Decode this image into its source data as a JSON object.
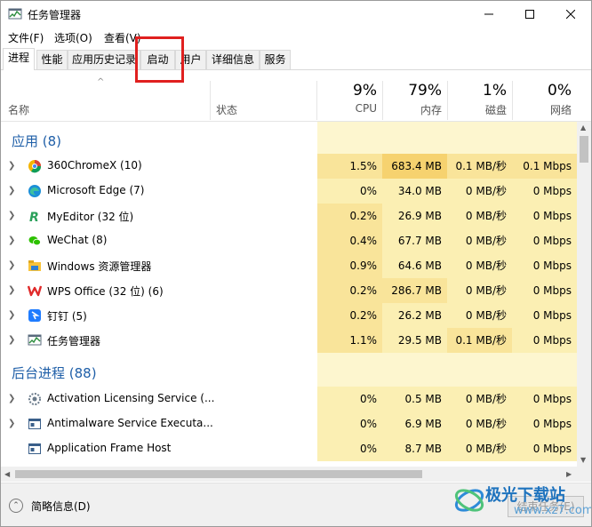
{
  "window": {
    "title": "任务管理器",
    "controls": {
      "minimize": "—",
      "maximize": "☐",
      "close": "✕"
    }
  },
  "menu": [
    "文件(F)",
    "选项(O)",
    "查看(V)"
  ],
  "tabs": [
    "进程",
    "性能",
    "应用历史记录",
    "启动",
    "用户",
    "详细信息",
    "服务"
  ],
  "active_tab": "进程",
  "header": {
    "sort_caret": "^",
    "name": "名称",
    "status": "状态",
    "columns": [
      {
        "pct": "9%",
        "label": "CPU"
      },
      {
        "pct": "79%",
        "label": "内存"
      },
      {
        "pct": "1%",
        "label": "磁盘"
      },
      {
        "pct": "0%",
        "label": "网络"
      }
    ]
  },
  "groups": [
    {
      "title": "应用 (8)",
      "rows": [
        {
          "name": "360ChromeX (10)",
          "icon": "360chrome-icon",
          "cpu": "1.5%",
          "mem": "683.4 MB",
          "disk": "0.1 MB/秒",
          "net": "0.1 Mbps"
        },
        {
          "name": "Microsoft Edge (7)",
          "icon": "edge-icon",
          "cpu": "0%",
          "mem": "34.0 MB",
          "disk": "0 MB/秒",
          "net": "0 Mbps"
        },
        {
          "name": "MyEditor (32 位)",
          "icon": "myeditor-icon",
          "cpu": "0.2%",
          "mem": "26.9 MB",
          "disk": "0 MB/秒",
          "net": "0 Mbps"
        },
        {
          "name": "WeChat (8)",
          "icon": "wechat-icon",
          "cpu": "0.4%",
          "mem": "67.7 MB",
          "disk": "0 MB/秒",
          "net": "0 Mbps"
        },
        {
          "name": "Windows 资源管理器",
          "icon": "explorer-icon",
          "cpu": "0.9%",
          "mem": "64.6 MB",
          "disk": "0 MB/秒",
          "net": "0 Mbps"
        },
        {
          "name": "WPS Office (32 位) (6)",
          "icon": "wps-icon",
          "cpu": "0.2%",
          "mem": "286.7 MB",
          "disk": "0 MB/秒",
          "net": "0 Mbps"
        },
        {
          "name": "钉钉 (5)",
          "icon": "dingtalk-icon",
          "cpu": "0.2%",
          "mem": "26.2 MB",
          "disk": "0 MB/秒",
          "net": "0 Mbps"
        },
        {
          "name": "任务管理器",
          "icon": "task-manager-icon",
          "cpu": "1.1%",
          "mem": "29.5 MB",
          "disk": "0.1 MB/秒",
          "net": "0 Mbps"
        }
      ]
    },
    {
      "title": "后台进程 (88)",
      "rows": [
        {
          "name": "Activation Licensing Service (...",
          "icon": "service-icon",
          "cpu": "0%",
          "mem": "0.5 MB",
          "disk": "0 MB/秒",
          "net": "0 Mbps"
        },
        {
          "name": "Antimalware Service Executa...",
          "icon": "app-window-icon",
          "cpu": "0%",
          "mem": "6.9 MB",
          "disk": "0 MB/秒",
          "net": "0 Mbps"
        },
        {
          "name": "Application Frame Host",
          "icon": "app-window-icon",
          "cpu": "0%",
          "mem": "8.7 MB",
          "disk": "0 MB/秒",
          "net": "0 Mbps"
        }
      ]
    }
  ],
  "footer": {
    "fewer_details": "简略信息(D)",
    "end_task": "结束任务(E)",
    "arrow": "⌃"
  },
  "watermark": {
    "text": "极光下载站",
    "url": "www.xz7.com"
  }
}
